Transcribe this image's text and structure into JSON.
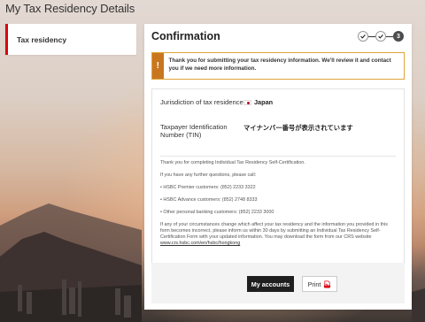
{
  "page": {
    "title": "My Tax Residency Details"
  },
  "sidebar": {
    "items": [
      {
        "label": "Tax residency"
      }
    ]
  },
  "confirmation": {
    "title": "Confirmation",
    "steps": [
      {
        "status": "completed",
        "icon": "check-icon"
      },
      {
        "status": "completed",
        "icon": "check-icon"
      },
      {
        "status": "current",
        "label": "3"
      }
    ],
    "notice": {
      "icon": "exclamation-icon",
      "text": "Thank you for submitting your tax residency information. We'll review it and contact you if we need more information."
    },
    "details": {
      "jurisdiction_label": "Jurisdiction of tax residence",
      "jurisdiction_value": "Japan",
      "tin_label": "Taxpayer Identification Number (TIN)",
      "tin_value": "マイナンバー番号が表示されています"
    },
    "info": {
      "line1": "Thank you for completing Individual Tax Residency Self-Certification.",
      "line2": "If you have any further questions, please call:",
      "hotlines": [
        "HSBC Premier customers: (852) 2233 3322",
        "HSBC Advance customers: (852) 2748 8333",
        "Other personal banking customers: (852) 2233 3000"
      ],
      "disclaimer": "If any of your circumstances change which affect your tax residency and the information you provided in this form becomes incorrect, please inform us within 30 days by submitting an Individual Tax Residency Self-Certification Form with your updated information. You may download the form from our CRS website",
      "website_link": "www.crs.hsbc.com/en/hsbc/hongkong"
    },
    "footer": {
      "primary_label": "My accounts",
      "print_label": "Print",
      "print_icon": "pdf-icon"
    }
  },
  "colors": {
    "brand_red": "#db0011",
    "warning_orange": "#c97621",
    "primary_button": "#1f1f1f"
  }
}
